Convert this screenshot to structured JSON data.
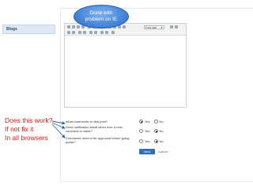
{
  "sidebar": {
    "blogs_label": "Blogs"
  },
  "editor": {
    "font_select_value": "Font size"
  },
  "callout": {
    "line1": "Done with",
    "line2": "problem on IE"
  },
  "annotation": {
    "lines": [
      "Does this work?",
      "If not fix it",
      "In all browsers"
    ]
  },
  "form": {
    "questions": [
      {
        "text": "Allow comments on this post?",
        "yes": "Yes",
        "no": "No",
        "selected": "yes"
      },
      {
        "text": "Send notification email when ever a new comment is made?",
        "yes": "Yes",
        "no": "No",
        "selected": "no"
      },
      {
        "text": "Comments need to be approved before going public?",
        "yes": "Yes",
        "no": "No",
        "selected": "no"
      }
    ],
    "next_label": "Next",
    "cancel_label": "Cancel"
  },
  "colors": {
    "annotation": "#e01818",
    "callout": "#3f7fd6",
    "primary_button": "#2d6fb9"
  }
}
